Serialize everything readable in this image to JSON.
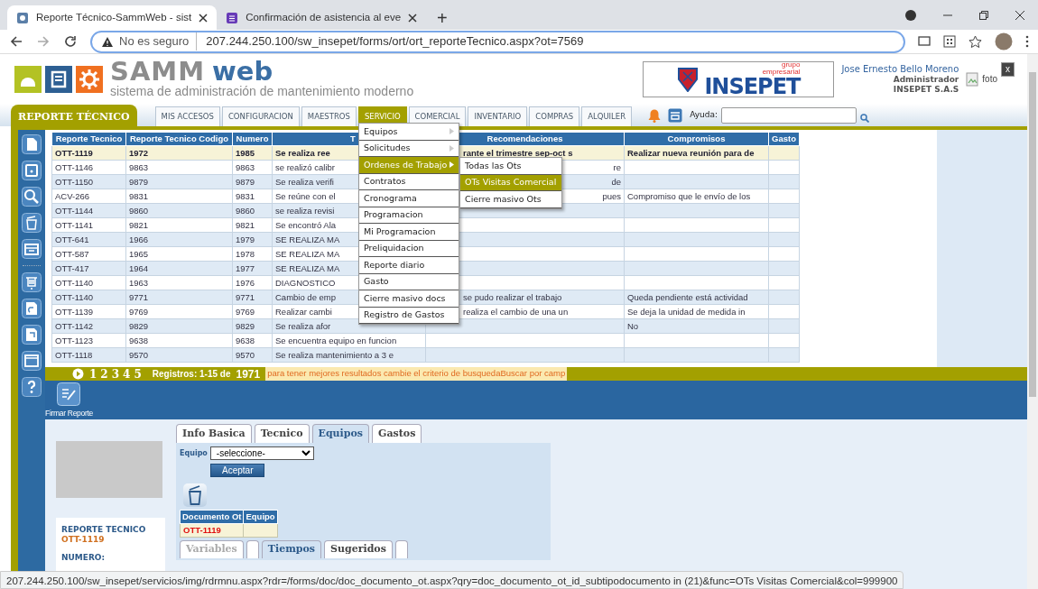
{
  "browser": {
    "tabs": [
      {
        "title": "Reporte Técnico-SammWeb - sist",
        "selected": true
      },
      {
        "title": "Confirmación de asistencia al eve",
        "selected": false
      }
    ],
    "new_tab": "+",
    "security": "No es seguro",
    "url": "207.244.250.100/sw_insepet/forms/ort/ort_reporteTecnico.aspx?ot=7569"
  },
  "header": {
    "brand": {
      "name": "SAMM",
      "suffix": "web"
    },
    "tagline": "sistema de administración de mantenimiento moderno",
    "company_logo": {
      "group": "grupo",
      "group_suffix": "empresarial",
      "name": "INSEPET"
    },
    "user": {
      "name": "Jose Ernesto Bello Moreno",
      "role": "Administrador",
      "company": "INSEPET S.A.S",
      "photo_alt": "foto",
      "close": "x"
    }
  },
  "nav": {
    "module": "REPORTE TÉCNICO",
    "items": [
      {
        "label": "MIS ACCESOS",
        "selected": false
      },
      {
        "label": "CONFIGURACION",
        "selected": false
      },
      {
        "label": "MAESTROS",
        "selected": false
      },
      {
        "label": "SERVICIO",
        "selected": true
      },
      {
        "label": "COMERCIAL",
        "selected": false
      },
      {
        "label": "INVENTARIO",
        "selected": false
      },
      {
        "label": "COMPRAS",
        "selected": false
      },
      {
        "label": "ALQUILER",
        "selected": false
      }
    ],
    "help_label": "Ayuda:"
  },
  "menu": {
    "items": [
      {
        "label": "Equipos",
        "submenu": true,
        "selected": false
      },
      {
        "label": "Solicitudes",
        "submenu": true,
        "selected": false
      },
      {
        "label": "Ordenes de Trabajo",
        "submenu": true,
        "selected": true
      },
      {
        "label": "Contratos",
        "submenu": false,
        "selected": false
      },
      {
        "label": "Cronograma",
        "submenu": false,
        "selected": false
      },
      {
        "label": "Programacion",
        "submenu": false,
        "selected": false
      },
      {
        "label": "Mi Programacion",
        "submenu": false,
        "selected": false
      },
      {
        "label": "Preliquidacion",
        "submenu": false,
        "selected": false
      },
      {
        "label": "Reporte diario",
        "submenu": false,
        "selected": false
      },
      {
        "label": "Gasto",
        "submenu": false,
        "selected": false
      },
      {
        "label": "Cierre masivo docs",
        "submenu": false,
        "selected": false
      },
      {
        "label": "Registro de Gastos",
        "submenu": false,
        "selected": false
      }
    ],
    "submenu": [
      {
        "label": "Todas las Ots",
        "selected": false
      },
      {
        "label": "OTs Visitas Comercial",
        "selected": true
      },
      {
        "label": "Cierre masivo Ots",
        "selected": false
      }
    ]
  },
  "table": {
    "columns": [
      "Reporte Tecnico",
      "Reporte Tecnico Codigo",
      "Numero",
      "T",
      "Recomendaciones",
      "Compromisos",
      "Gasto"
    ],
    "rows": [
      {
        "selected": true,
        "cells": [
          "OTT-1119",
          "1972",
          "1985",
          "Se realiza ree",
          "rante el trimestre sep-oct s",
          "Realizar nueva reunión para de",
          ""
        ]
      },
      {
        "selected": false,
        "cells": [
          "OTT-1146",
          "9863",
          "9863",
          "se realizó calibr",
          "re",
          "",
          ""
        ]
      },
      {
        "selected": false,
        "cells": [
          "OTT-1150",
          "9879",
          "9879",
          "Se realiza verifi",
          "de",
          "",
          ""
        ]
      },
      {
        "selected": false,
        "cells": [
          "ACV-266",
          "9831",
          "9831",
          "Se reúne con el",
          "pues",
          "Compromiso que le envío de los",
          ""
        ]
      },
      {
        "selected": false,
        "cells": [
          "OTT-1144",
          "9860",
          "9860",
          "se realiza revisi",
          "",
          "",
          ""
        ]
      },
      {
        "selected": false,
        "cells": [
          "OTT-1141",
          "9821",
          "9821",
          "Se encontró Ala",
          "",
          "",
          ""
        ]
      },
      {
        "selected": false,
        "cells": [
          "OTT-641",
          "1966",
          "1979",
          "SE REALIZA MA",
          "",
          "",
          ""
        ]
      },
      {
        "selected": false,
        "cells": [
          "OTT-587",
          "1965",
          "1978",
          "SE REALIZA MA",
          "",
          "",
          ""
        ]
      },
      {
        "selected": false,
        "cells": [
          "OTT-417",
          "1964",
          "1977",
          "SE REALIZA MA",
          "",
          "",
          ""
        ]
      },
      {
        "selected": false,
        "cells": [
          "OTT-1140",
          "1963",
          "1976",
          "DIAGNOSTICO",
          "",
          "",
          ""
        ]
      },
      {
        "selected": false,
        "cells": [
          "OTT-1140",
          "9771",
          "9771",
          "Cambio de emp",
          "se pudo realizar el trabajo",
          "Queda pendiente está actividad",
          ""
        ]
      },
      {
        "selected": false,
        "cells": [
          "OTT-1139",
          "9769",
          "9769",
          "Realizar cambi",
          "realiza el cambio de una un",
          "Se deja la unidad de medida in",
          ""
        ]
      },
      {
        "selected": false,
        "cells": [
          "OTT-1142",
          "9829",
          "9829",
          "Se realiza afor",
          "",
          "No",
          ""
        ]
      },
      {
        "selected": false,
        "cells": [
          "OTT-1123",
          "9638",
          "9638",
          "Se encuentra equipo en funcion",
          "",
          "",
          ""
        ]
      },
      {
        "selected": false,
        "cells": [
          "OTT-1118",
          "9570",
          "9570",
          "Se realiza mantenimiento a 3 e",
          "",
          "",
          ""
        ]
      }
    ]
  },
  "pager": {
    "pages": [
      "1",
      "2",
      "3",
      "4",
      "5"
    ],
    "records_label": "Registros: 1-15 de",
    "total": "1971",
    "hint": "para tener mejores resultados cambie el criterio de busquedaBuscar por camp"
  },
  "actions": {
    "sign_label": "Firmar Reporte"
  },
  "detail": {
    "card": {
      "title": "REPORTE TECNICO",
      "code": "OTT-1119",
      "number_label": "NUMERO:"
    },
    "tabs": [
      {
        "label": "Info Basica",
        "selected": false
      },
      {
        "label": "Tecnico",
        "selected": false
      },
      {
        "label": "Equipos",
        "selected": true
      },
      {
        "label": "Gastos",
        "selected": false
      }
    ],
    "equipment_label": "Equipo",
    "equipment_value": "-seleccione-",
    "accept": "Aceptar",
    "doc_table": {
      "columns": [
        "Documento Ot",
        "Equipo"
      ],
      "rows": [
        [
          "OTT-1119",
          ""
        ]
      ]
    },
    "lower_tabs": [
      {
        "kind": "tab",
        "label": "Variables",
        "selected": false,
        "disabled": true
      },
      {
        "kind": "blank",
        "selected": false,
        "disabled": false
      },
      {
        "kind": "tab",
        "label": "Tiempos",
        "selected": true,
        "disabled": false
      },
      {
        "kind": "tab",
        "label": "Sugeridos",
        "selected": false,
        "disabled": false
      },
      {
        "kind": "blank",
        "selected": false,
        "disabled": false
      }
    ]
  },
  "status_bar": "207.244.250.100/sw_insepet/servicios/img/rdrmnu.aspx?rdr=/forms/doc/doc_documento_ot.aspx?qry=doc_documento_ot_id_subtipodocumento in (21)&func=OTs Visitas Comercial&col=999900"
}
